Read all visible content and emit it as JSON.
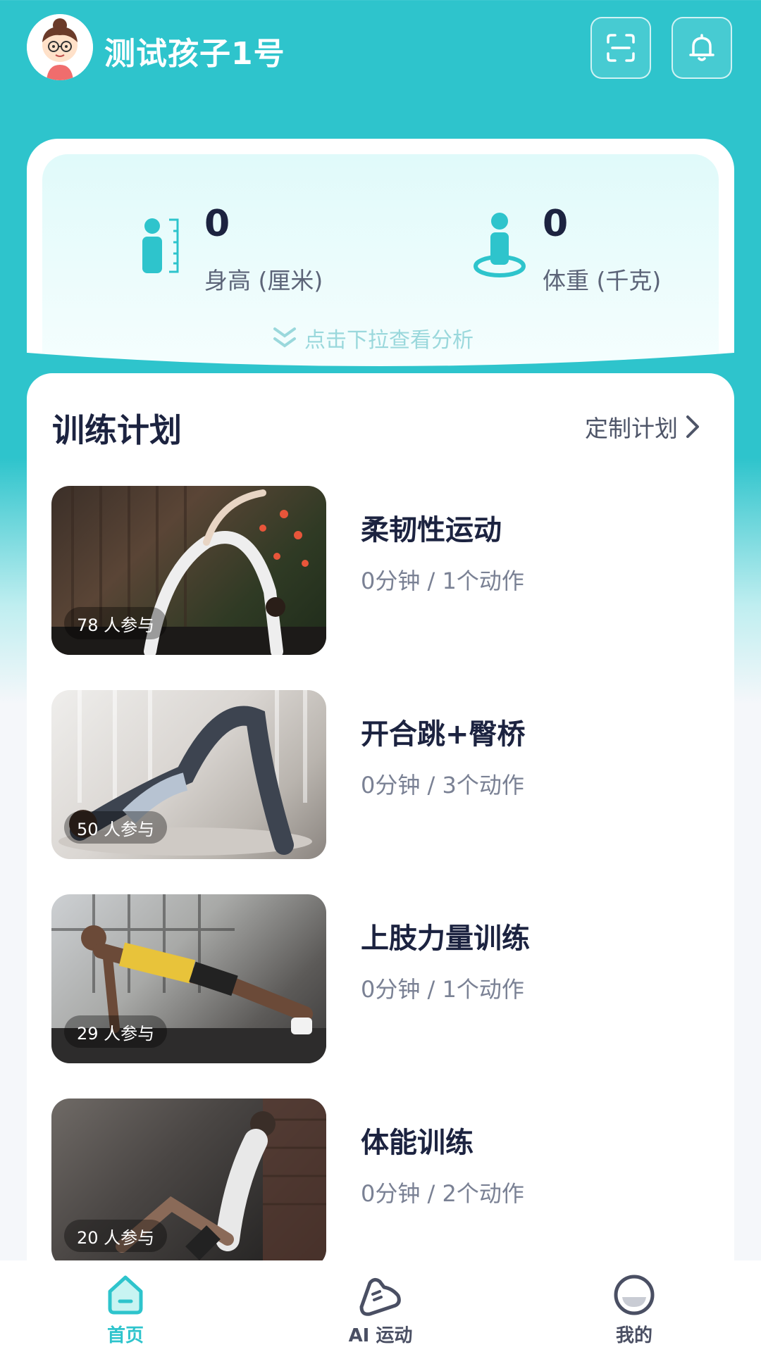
{
  "header": {
    "username": "测试孩子1号",
    "icons": {
      "avatar": "cartoon-girl-avatar",
      "scan": "scan-icon",
      "bell": "bell-icon"
    }
  },
  "stats": {
    "height_value": "0",
    "height_label": "身高 (厘米)",
    "weight_value": "0",
    "weight_label": "体重 (千克)",
    "pull_hint": "点击下拉查看分析"
  },
  "plans": {
    "title": "训练计划",
    "custom_label": "定制计划",
    "items": [
      {
        "name": "柔韧性运动",
        "meta": "0分钟 / 1个动作",
        "participants": "78 人参与"
      },
      {
        "name": "开合跳+臀桥",
        "meta": "0分钟 / 3个动作",
        "participants": "50 人参与"
      },
      {
        "name": "上肢力量训练",
        "meta": "0分钟 / 1个动作",
        "participants": "29 人参与"
      },
      {
        "name": "体能训练",
        "meta": "0分钟 / 2个动作",
        "participants": "20 人参与"
      }
    ]
  },
  "nav": {
    "home": "首页",
    "ai": "AI 运动",
    "mine": "我的"
  },
  "colors": {
    "accent": "#2ec4cc",
    "text_dark": "#1c2340",
    "text_muted": "#7a8194"
  }
}
